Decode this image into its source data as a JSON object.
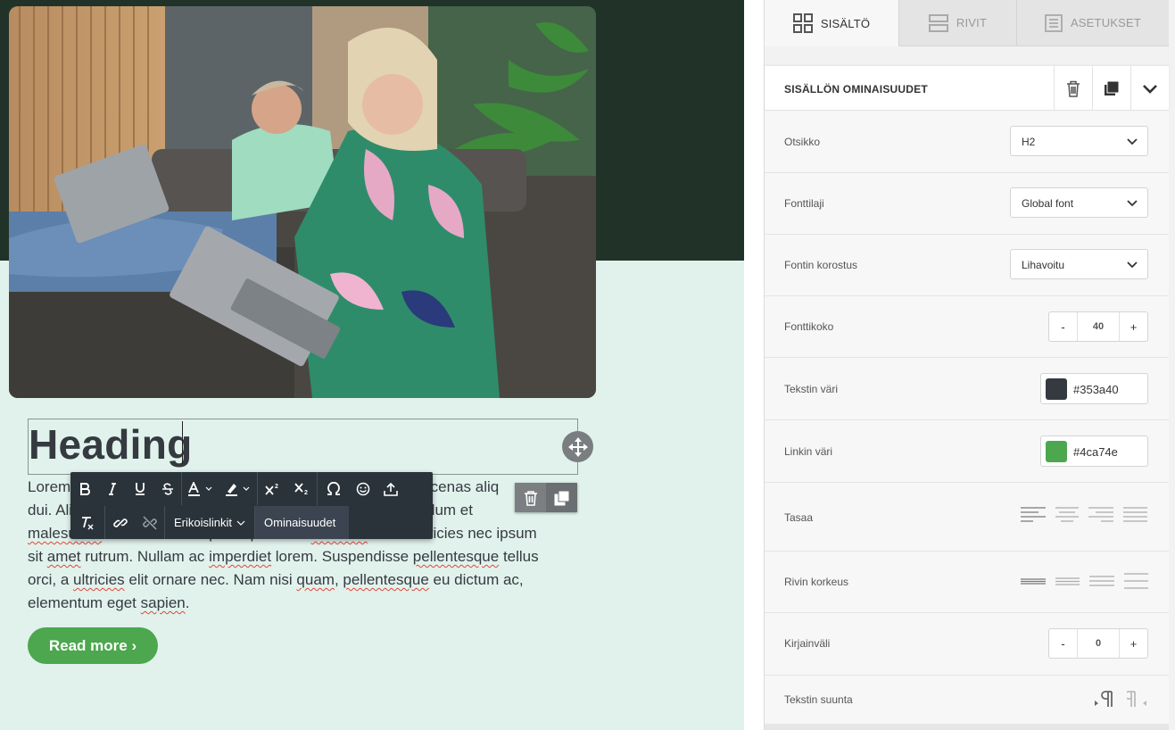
{
  "canvas": {
    "heading": "Heading",
    "body_segments": [
      {
        "t": "Lorem ",
        "s": false
      },
      {
        "t": "                                             ",
        "s": false
      },
      {
        "t": "aecenas aliq",
        "s": false
      },
      {
        "t": "",
        "s": false
      }
    ],
    "body_lines": [
      [
        {
          "t": "Lorem ",
          "s": false
        },
        {
          "t": "ipsum dolor sit amet, consectetur adipiscing elit. Maecenas aliq",
          "s": false
        }
      ],
      [
        {
          "t": "dui. Aliquam ",
          "s": false
        },
        {
          "t": "erat volutpat. Aenean sit amet lectus nec. Interdum et",
          "s": false
        }
      ],
      [
        {
          "t": "malesuada",
          "s": true
        },
        {
          "t": " fames ac ante ipsum primis in ",
          "s": false
        },
        {
          "t": "faucibus",
          "s": true
        },
        {
          "t": ". Nam ultricies nec ipsum",
          "s": false
        }
      ],
      [
        {
          "t": "sit ",
          "s": false
        },
        {
          "t": "amet",
          "s": true
        },
        {
          "t": " rutrum. Nullam ac ",
          "s": false
        },
        {
          "t": "imperdiet",
          "s": true
        },
        {
          "t": " lorem. Suspendisse ",
          "s": false
        },
        {
          "t": "pellentesque",
          "s": true
        },
        {
          "t": " tellus",
          "s": false
        }
      ],
      [
        {
          "t": "orci, a ",
          "s": false
        },
        {
          "t": "ultricies",
          "s": true
        },
        {
          "t": " elit ornare nec. Nam nisi ",
          "s": false
        },
        {
          "t": "quam",
          "s": true
        },
        {
          "t": ", ",
          "s": false
        },
        {
          "t": "pellentesque",
          "s": true
        },
        {
          "t": " eu dictum ac,",
          "s": false
        }
      ],
      [
        {
          "t": "elementum eget ",
          "s": false
        },
        {
          "t": "sapien",
          "s": true
        },
        {
          "t": ".",
          "s": false
        }
      ]
    ],
    "read_more": "Read more ›",
    "accent_color": "#4ca74e",
    "dark_band_color": "#213329",
    "bg_color": "#e1f2ec"
  },
  "toolbar": {
    "row1": [
      "bold-icon",
      "italic-icon",
      "underline-icon",
      "strikethrough-icon",
      "text-color-icon",
      "highlight-icon",
      "superscript-icon",
      "subscript-icon",
      "special-char-icon",
      "emoji-icon",
      "upload-icon"
    ],
    "special_links": "Erikoislinkit",
    "properties": "Ominaisuudet"
  },
  "tabs": [
    {
      "id": "content",
      "label": "SISÄLTÖ",
      "icon": "grid-icon",
      "active": true
    },
    {
      "id": "rows",
      "label": "RIVIT",
      "icon": "rows-icon",
      "active": false
    },
    {
      "id": "settings",
      "label": "ASETUKSET",
      "icon": "document-icon",
      "active": false
    }
  ],
  "panel": {
    "title": "SISÄLLÖN OMINAISUUDET",
    "heading_label": "Otsikko",
    "heading_value": "H2",
    "font_label": "Fonttilaji",
    "font_value": "Global font",
    "weight_label": "Fontin korostus",
    "weight_value": "Lihavoitu",
    "size_label": "Fonttikoko",
    "size_minus": "-",
    "size_value": "40",
    "size_plus": "+",
    "text_color_label": "Tekstin väri",
    "text_color_value": "#353a40",
    "link_color_label": "Linkin väri",
    "link_color_value": "#4ca74e",
    "align_label": "Tasaa",
    "line_height_label": "Rivin korkeus",
    "letter_spacing_label": "Kirjainväli",
    "letter_minus": "-",
    "letter_value": "0",
    "letter_plus": "+",
    "direction_label": "Tekstin suunta"
  }
}
